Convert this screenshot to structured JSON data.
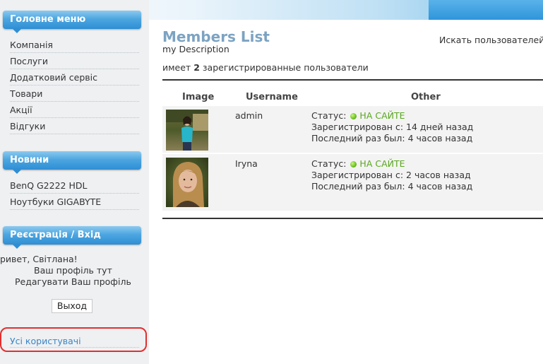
{
  "sidebar": {
    "main_menu": {
      "title": "Головне меню",
      "items": [
        "Компанія",
        "Послуги",
        "Додатковий сервіс",
        "Товари",
        "Акції",
        "Відгуки"
      ]
    },
    "news": {
      "title": "Новини",
      "items": [
        "BenQ G2222 HDL",
        "Ноутбуки GIGABYTE"
      ]
    },
    "login": {
      "title": "Реєстрація / Вхід",
      "greeting": "ривет, Світлана!",
      "profile_link": "Ваш профіль тут",
      "edit_profile": "Редагувати Ваш профіль",
      "logout": "Выход"
    },
    "all_users": "Усі користувачі"
  },
  "main": {
    "title": "Members List",
    "description": "my Description",
    "search": "Искать пользователей",
    "count_prefix": "имеет",
    "count": "2",
    "count_suffix": "зарегистрированные пользователи",
    "columns": [
      "Image",
      "Username",
      "Other"
    ],
    "members": [
      {
        "username": "admin",
        "status_label": "Статус:",
        "status_value": "НА САЙТЕ",
        "registered": "Зарегистрирован с: 14 дней назад",
        "last_seen": "Последний раз был: 4 часов назад"
      },
      {
        "username": "Iryna",
        "status_label": "Статус:",
        "status_value": "НА САЙТЕ",
        "registered": "Зарегистрирован с: 2 часов назад",
        "last_seen": "Последний раз был: 4 часов назад"
      }
    ]
  },
  "colors": {
    "accent": "#2e8ed4",
    "title": "#7ca3c2",
    "online": "#5aa81e",
    "highlight": "#e03030"
  }
}
